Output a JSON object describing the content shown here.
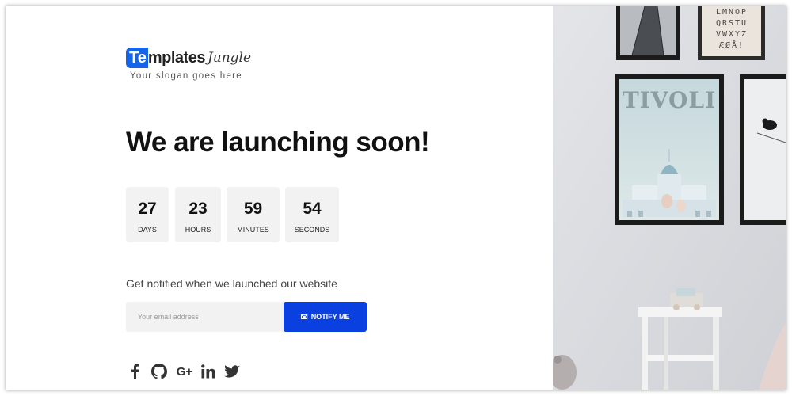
{
  "brand": {
    "badge": "Te",
    "name_rest": "mplates",
    "script": "Jungle",
    "slogan": "Your slogan goes here",
    "accent": "#1565e8"
  },
  "headline": "We are launching soon!",
  "countdown": [
    {
      "value": "27",
      "label": "DAYS"
    },
    {
      "value": "23",
      "label": "HOURS"
    },
    {
      "value": "59",
      "label": "MINUTES"
    },
    {
      "value": "54",
      "label": "SECONDS"
    }
  ],
  "notify": {
    "prompt": "Get notified when we launched our website",
    "placeholder": "Your email address",
    "button_label": "NOTIFY ME",
    "button_icon": "envelope-icon",
    "button_color": "#0a3fe0"
  },
  "social": [
    "facebook-icon",
    "github-icon",
    "google-plus-icon",
    "linkedin-icon",
    "twitter-icon"
  ],
  "photo": {
    "poster_text": "TIVOLI",
    "alphabet_lines": [
      "LMNOP",
      "QRSTU",
      "VWXYZ",
      "ÆØÅ!"
    ]
  }
}
